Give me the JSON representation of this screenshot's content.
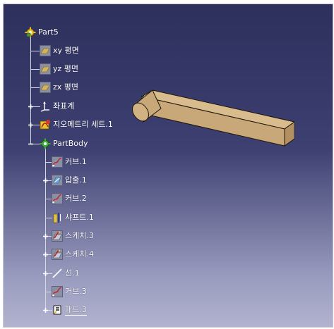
{
  "tree": {
    "root": {
      "label": "Part5",
      "icon": "part-gear-icon"
    },
    "planes": [
      {
        "label": "xy 평면",
        "icon": "plane-icon"
      },
      {
        "label": "yz 평면",
        "icon": "plane-icon"
      },
      {
        "label": "zx 평면",
        "icon": "plane-icon"
      }
    ],
    "axis_system": {
      "label": "좌표계",
      "icon": "axis-system-icon"
    },
    "geometric_set": {
      "label": "지오메트리 세트.1",
      "icon": "geometric-set-icon"
    },
    "part_body": {
      "label": "PartBody",
      "icon": "part-body-icon"
    },
    "body_items": [
      {
        "label": "커브.1",
        "icon": "curve-icon",
        "expandable": false
      },
      {
        "label": "압출.1",
        "icon": "extrude-icon",
        "expandable": true
      },
      {
        "label": "커브.2",
        "icon": "curve-icon",
        "expandable": false
      },
      {
        "label": "샤프트.1",
        "icon": "shaft-icon",
        "expandable": false
      },
      {
        "label": "스케치.3",
        "icon": "sketch-icon",
        "expandable": true
      },
      {
        "label": "스케치.4",
        "icon": "sketch-icon",
        "expandable": true
      },
      {
        "label": "선.1",
        "icon": "line-icon",
        "expandable": true
      },
      {
        "label": "커브.3",
        "icon": "curve-icon",
        "expandable": false
      },
      {
        "label": "패드.3",
        "icon": "pad-icon",
        "expandable": true,
        "selected": true
      }
    ]
  },
  "colors": {
    "background_top": "#2d2f5c",
    "background_bottom": "#b2b3cf",
    "model_face": "#c8a878",
    "model_top": "#d9bc8e",
    "model_edge": "#1e1608"
  }
}
